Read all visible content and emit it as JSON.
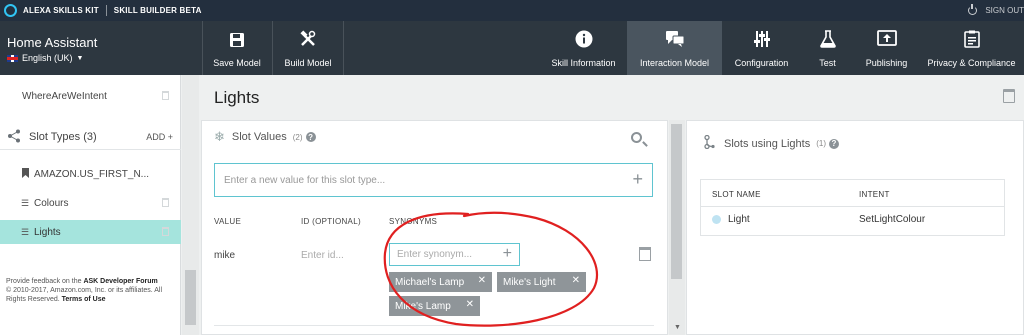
{
  "topbar": {
    "kit_label": "ALEXA SKILLS KIT",
    "builder_label": "SKILL BUILDER BETA",
    "signout_label": "SIGN OUT"
  },
  "header": {
    "app_name": "Home Assistant",
    "language": "English (UK)",
    "buttons": {
      "save_model": "Save Model",
      "build_model": "Build Model",
      "skill_information": "Skill Information",
      "interaction_model": "Interaction Model",
      "configuration": "Configuration",
      "test": "Test",
      "publishing": "Publishing",
      "privacy": "Privacy & Compliance"
    }
  },
  "sidebar": {
    "intent_item": "WhereAreWeIntent",
    "slot_types_label": "Slot Types (3)",
    "add_label": "ADD",
    "slot_types": [
      "AMAZON.US_FIRST_N...",
      "Colours",
      "Lights"
    ],
    "active_index": 2,
    "footer": {
      "feedback_prefix": "Provide feedback on the",
      "feedback_link": "ASK Developer Forum",
      "copyright": "© 2010-2017, Amazon.com, Inc. or its affiliates. All Rights Reserved.",
      "terms": "Terms of Use"
    }
  },
  "main": {
    "title": "Lights",
    "slot_values": {
      "heading": "Slot Values",
      "count": "(2)",
      "new_value_placeholder": "Enter a new value for this slot type...",
      "columns": {
        "value": "VALUE",
        "id": "ID (OPTIONAL)",
        "synonyms": "SYNONYMS"
      },
      "row": {
        "value": "mike",
        "id_placeholder": "Enter id...",
        "synonym_placeholder": "Enter synonym...",
        "synonyms": [
          "Michael's Lamp",
          "Mike's Light",
          "Mike's Lamp"
        ]
      }
    }
  },
  "right": {
    "heading": "Slots using Lights",
    "count": "(1)",
    "columns": {
      "slot_name": "SLOT NAME",
      "intent": "INTENT"
    },
    "rows": [
      {
        "slot_name": "Light",
        "intent": "SetLightColour"
      }
    ]
  },
  "colors": {
    "topbar": "#232f3e",
    "header": "#2d3740",
    "active_tab": "#4a555f",
    "selected_slot": "#a5e4dd",
    "focus": "#5fc4d0",
    "chip": "#8f9599",
    "annotation": "#e02020"
  },
  "icons": [
    "power-icon",
    "save-icon",
    "build-icon",
    "info-icon",
    "chat-icon",
    "sliders-icon",
    "flask-icon",
    "publish-icon",
    "clipboard-icon",
    "search-icon",
    "trash-icon",
    "plus-icon",
    "help-icon"
  ]
}
